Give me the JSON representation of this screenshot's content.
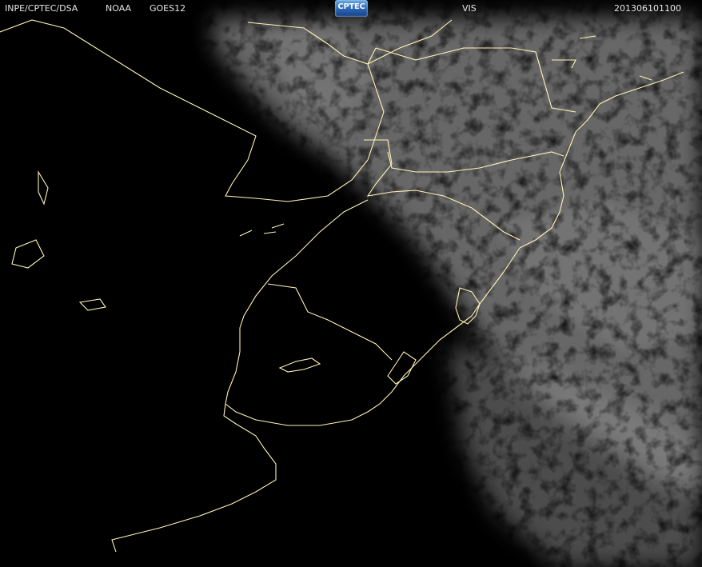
{
  "header": {
    "source": "INPE/CPTEC/DSA",
    "agency": "NOAA",
    "satellite": "GOES12",
    "channel": "VIS",
    "timestamp": "201306101100",
    "logo_text": "CPTEC"
  },
  "map": {
    "background_color": "#000000",
    "cloud_color": "#8a8a8a",
    "border_color": "#fff4b8",
    "icons": [
      "cptec-logo-icon"
    ]
  }
}
